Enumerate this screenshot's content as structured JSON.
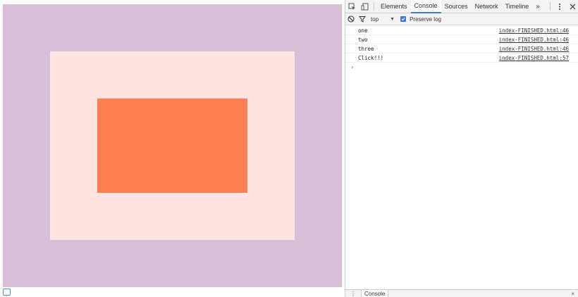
{
  "page": {
    "colors": {
      "outer": "#d8bfd8",
      "middle": "#ffe4e1",
      "inner": "#ff7f50"
    }
  },
  "devtools": {
    "tabs": [
      {
        "label": "Elements"
      },
      {
        "label": "Console"
      },
      {
        "label": "Sources"
      },
      {
        "label": "Network"
      },
      {
        "label": "Timeline"
      }
    ],
    "more_label": "»",
    "active_tab": "Console",
    "toolbar": {
      "context": "top",
      "preserve_log_label": "Preserve log",
      "preserve_log_checked": true
    },
    "console_rows": [
      {
        "message": "one",
        "source": "index-FINISHED.html:46"
      },
      {
        "message": "two",
        "source": "index-FINISHED.html:46"
      },
      {
        "message": "three",
        "source": "index-FINISHED.html:46"
      },
      {
        "message": "Click!!!",
        "source": "index-FINISHED.html:57"
      }
    ],
    "prompt_symbol": "›",
    "drawer": {
      "tab_label": "Console",
      "close_symbol": "×"
    },
    "icons": [
      "inspect-icon",
      "device-toggle-icon",
      "kebab-menu-icon",
      "close-icon",
      "clear-console-icon",
      "filter-icon",
      "dropdown-arrow-icon",
      "checkbox-icon"
    ]
  }
}
